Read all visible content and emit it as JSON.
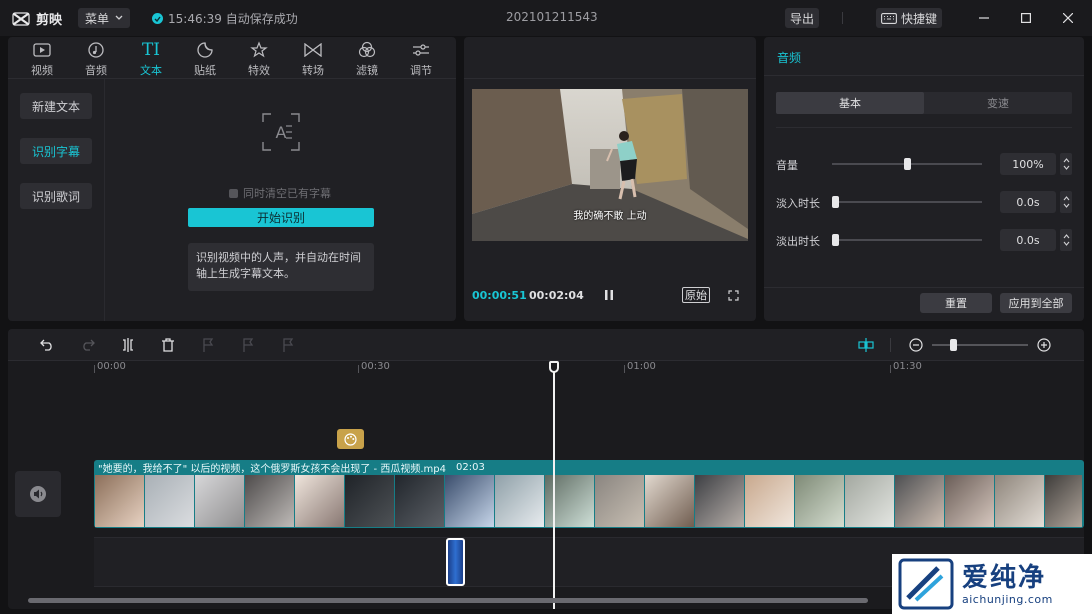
{
  "app": {
    "name": "剪映",
    "menu_label": "菜单"
  },
  "titlebar": {
    "save_status": "15:46:39 自动保存成功",
    "project_name": "202101211543",
    "export_label": "导出",
    "shortcut_label": "快捷键"
  },
  "media_tabs": [
    {
      "label": "视频",
      "icon": "video-icon"
    },
    {
      "label": "音频",
      "icon": "music-note-icon"
    },
    {
      "label": "文本",
      "icon": "text-icon",
      "active": true
    },
    {
      "label": "贴纸",
      "icon": "sticker-icon"
    },
    {
      "label": "特效",
      "icon": "sparkle-icon"
    },
    {
      "label": "转场",
      "icon": "transition-icon"
    },
    {
      "label": "滤镜",
      "icon": "filter-icon"
    },
    {
      "label": "调节",
      "icon": "adjust-sliders-icon"
    }
  ],
  "text_subnav": [
    {
      "label": "新建文本"
    },
    {
      "label": "识别字幕",
      "active": true
    },
    {
      "label": "识别歌词"
    }
  ],
  "recognize": {
    "clear_option": "同时清空已有字幕",
    "start_button": "开始识别",
    "description": "识别视频中的人声，并自动在时间轴上生成字幕文本。"
  },
  "preview": {
    "subtitle": "我的确不敢 上动",
    "current_time": "00:00:51",
    "total_time": "00:02:04",
    "original_label": "原始"
  },
  "inspector": {
    "title": "音频",
    "tabs": [
      "基本",
      "变速"
    ],
    "properties": [
      {
        "label": "音量",
        "value": "100%",
        "level": 0.5
      },
      {
        "label": "淡入时长",
        "value": "0.0s",
        "level": 0.0
      },
      {
        "label": "淡出时长",
        "value": "0.0s",
        "level": 0.0
      }
    ],
    "reset_label": "重置",
    "apply_all_label": "应用到全部"
  },
  "timeline": {
    "ruler": [
      "00:00",
      "00:30",
      "01:00",
      "01:30"
    ],
    "clip_title": "\"她要的，我给不了\" 以后的视频，这个俄罗斯女孩不会出现了 - 西瓜视频.mp4",
    "clip_duration": "02:03",
    "zoom_level": 0.2
  },
  "watermark": {
    "cn": "爱纯净",
    "url": "aichunjing.com"
  },
  "colors": {
    "accent": "#19c5d4",
    "clip": "#167d86",
    "panel": "#202024"
  }
}
